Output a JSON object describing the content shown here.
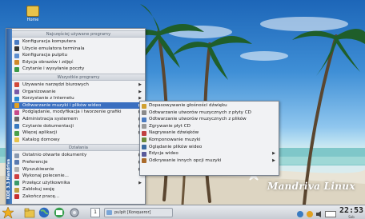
{
  "desktop": {
    "icon_label": "Home",
    "logo_text": "Mandriva Linux"
  },
  "menu": {
    "side_text": "KDE 3.3 Mandriva",
    "sections": [
      {
        "header": "Najczęściej używane programy",
        "items": [
          {
            "label": "Konfiguracja komputera",
            "icon_color": "#4a7bc2",
            "arrow": false
          },
          {
            "label": "Użycie emulatora terminala",
            "icon_color": "#333333",
            "arrow": false
          },
          {
            "label": "Konfiguracja pulpitu",
            "icon_color": "#5d8fd0",
            "arrow": false
          },
          {
            "label": "Edycja obrazów i zdjęć",
            "icon_color": "#d08a2a",
            "arrow": false
          },
          {
            "label": "Czytanie i wysyłanie poczty",
            "icon_color": "#3b9a48",
            "arrow": false
          }
        ]
      },
      {
        "header": "Wszystkie programy",
        "items": [
          {
            "label": "Używanie narzędzi biurowych",
            "icon_color": "#d24a3a",
            "arrow": true
          },
          {
            "label": "Organizowanie",
            "icon_color": "#7a5aa8",
            "arrow": true
          },
          {
            "label": "Korzystanie z Internetu",
            "icon_color": "#2a8bd0",
            "arrow": true
          },
          {
            "label": "Odtwarzanie muzyki i plików wideo",
            "icon_color": "#e0a020",
            "arrow": true,
            "selected": true
          },
          {
            "label": "Podglądanie, modyfikacja i tworzenie grafiki",
            "icon_color": "#c84a8a",
            "arrow": true
          },
          {
            "label": "Administracja systemem",
            "icon_color": "#6a6a6a",
            "arrow": true
          },
          {
            "label": "Czytanie dokumentacji",
            "icon_color": "#3a7ac0",
            "arrow": true
          },
          {
            "label": "Więcej aplikacji",
            "icon_color": "#4aa04a",
            "arrow": true
          },
          {
            "label": "Katalog domowy",
            "icon_color": "#e8c34a",
            "arrow": false
          }
        ]
      },
      {
        "header": "Działania",
        "items": [
          {
            "label": "Ostatnio otwarte dokumenty",
            "icon_color": "#8a9ab0",
            "arrow": true
          },
          {
            "label": "Preferencje",
            "icon_color": "#5a7ab0",
            "arrow": true
          },
          {
            "label": "Wyszukiwanie",
            "icon_color": "#b0b0b0",
            "arrow": true
          },
          {
            "label": "Wykonaj polecenie...",
            "icon_color": "#d04040",
            "arrow": false
          },
          {
            "label": "Przełącz użytkownika",
            "icon_color": "#3a9a6a",
            "arrow": true
          },
          {
            "label": "Zablokuj sesję",
            "icon_color": "#c0a040",
            "arrow": false
          },
          {
            "label": "Zakończ pracę...",
            "icon_color": "#c83030",
            "arrow": false
          }
        ]
      }
    ]
  },
  "submenu": {
    "items": [
      {
        "label": "Dopasowywanie głośności dźwięku",
        "icon_color": "#d0a030",
        "arrow": false
      },
      {
        "label": "Odtwarzanie utworów muzycznych z płyty CD",
        "icon_color": "#8a8a8a",
        "arrow": false
      },
      {
        "label": "Odtwarzanie utworów muzycznych z plików",
        "icon_color": "#4a7ac0",
        "arrow": false
      },
      {
        "label": "Zgrywanie płyt CD",
        "icon_color": "#9a9a9a",
        "arrow": false
      },
      {
        "label": "Nagrywanie dźwięków",
        "icon_color": "#c04040",
        "arrow": false
      },
      {
        "label": "Komponowanie muzyki",
        "icon_color": "#6a8a3a",
        "arrow": false
      },
      {
        "label": "Oglądanie plików wideo",
        "icon_color": "#3a6aa0",
        "arrow": false
      },
      {
        "label": "Edycja wideo",
        "icon_color": "#5a5a9a",
        "arrow": true
      },
      {
        "label": "Odkrywanie innych opcji muzyki",
        "icon_color": "#aa6a2a",
        "arrow": true
      }
    ]
  },
  "taskbar": {
    "pager_label": "1",
    "window_label": "pulpit [Konqueror]",
    "clock_time": "22:53",
    "clock_date": "Sob"
  }
}
